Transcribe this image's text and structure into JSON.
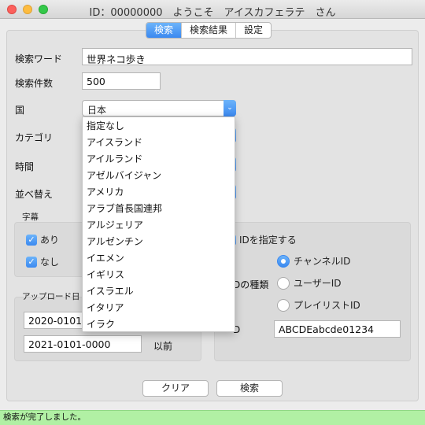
{
  "window": {
    "title": "ID：00000000　ようこそ　アイスカフェラテ　さん"
  },
  "tabs": [
    {
      "label": "検索"
    },
    {
      "label": "検索結果"
    },
    {
      "label": "設定"
    }
  ],
  "form": {
    "keyword_label": "検索ワード",
    "keyword_value": "世界ネコ歩き",
    "count_label": "検索件数",
    "count_value": "500",
    "country_label": "国",
    "country_value": "日本",
    "category_label": "カテゴリ",
    "time_label": "時間",
    "sort_label": "並べ替え"
  },
  "subtitles": {
    "label": "字幕",
    "yes_label": "あり",
    "no_label": "なし"
  },
  "upload": {
    "label": "アップロード日",
    "from_value": "2020-0101",
    "to_value": "2021-0101-0000",
    "to_suffix": "以前"
  },
  "id_group": {
    "specify_label": "IDを指定する",
    "type_label": "Dの種類",
    "channel_label": "チャンネルID",
    "user_label": "ユーザーID",
    "playlist_label": "プレイリストID",
    "id_label": "D",
    "id_value": "ABCDEabcde01234"
  },
  "country_options": [
    "指定なし",
    "アイスランド",
    "アイルランド",
    "アゼルバイジャン",
    "アメリカ",
    "アラブ首長国連邦",
    "アルジェリア",
    "アルゼンチン",
    "イエメン",
    "イギリス",
    "イスラエル",
    "イタリア",
    "イラク"
  ],
  "buttons": {
    "clear_label": "クリア",
    "search_label": "検索"
  },
  "status": {
    "message": "検索が完了しました。"
  }
}
